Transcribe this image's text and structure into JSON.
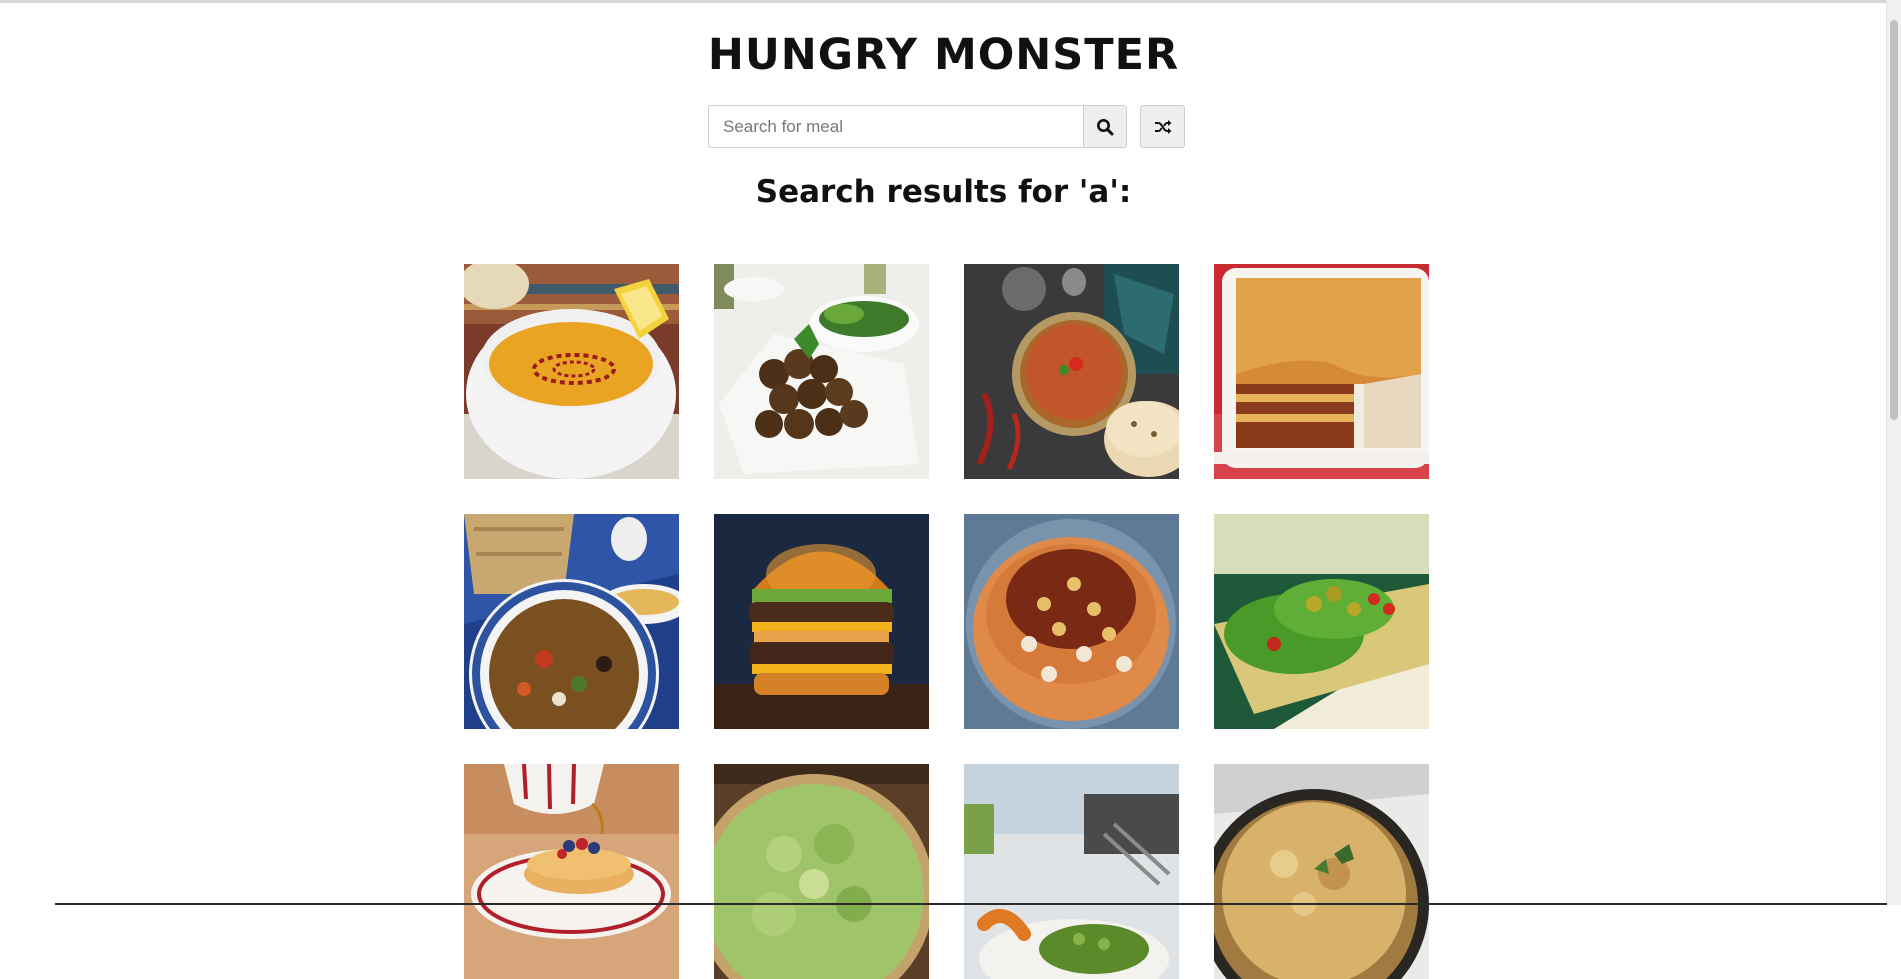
{
  "app": {
    "title": "HUNGRY MONSTER"
  },
  "search": {
    "placeholder": "Search for meal",
    "value": "",
    "search_icon": "search-icon",
    "random_icon": "shuffle-icon"
  },
  "results": {
    "heading": "Search results for 'a':"
  },
  "colors": {
    "button_bg": "#eeeeee",
    "border": "#cfcfcf",
    "text": "#111111"
  },
  "meals": [
    {
      "image": "lentil-soup-photo"
    },
    {
      "image": "falafel-photo"
    },
    {
      "image": "curry-with-naan-photo"
    },
    {
      "image": "lasagne-photo"
    },
    {
      "image": "tunisian-salad-photo"
    },
    {
      "image": "double-cheeseburger-photo"
    },
    {
      "image": "koshari-photo"
    },
    {
      "image": "nachos-photo"
    },
    {
      "image": "pancakes-photo"
    },
    {
      "image": "leek-quiche-photo"
    },
    {
      "image": "green-dish-photo"
    },
    {
      "image": "baked-casserole-photo"
    }
  ]
}
